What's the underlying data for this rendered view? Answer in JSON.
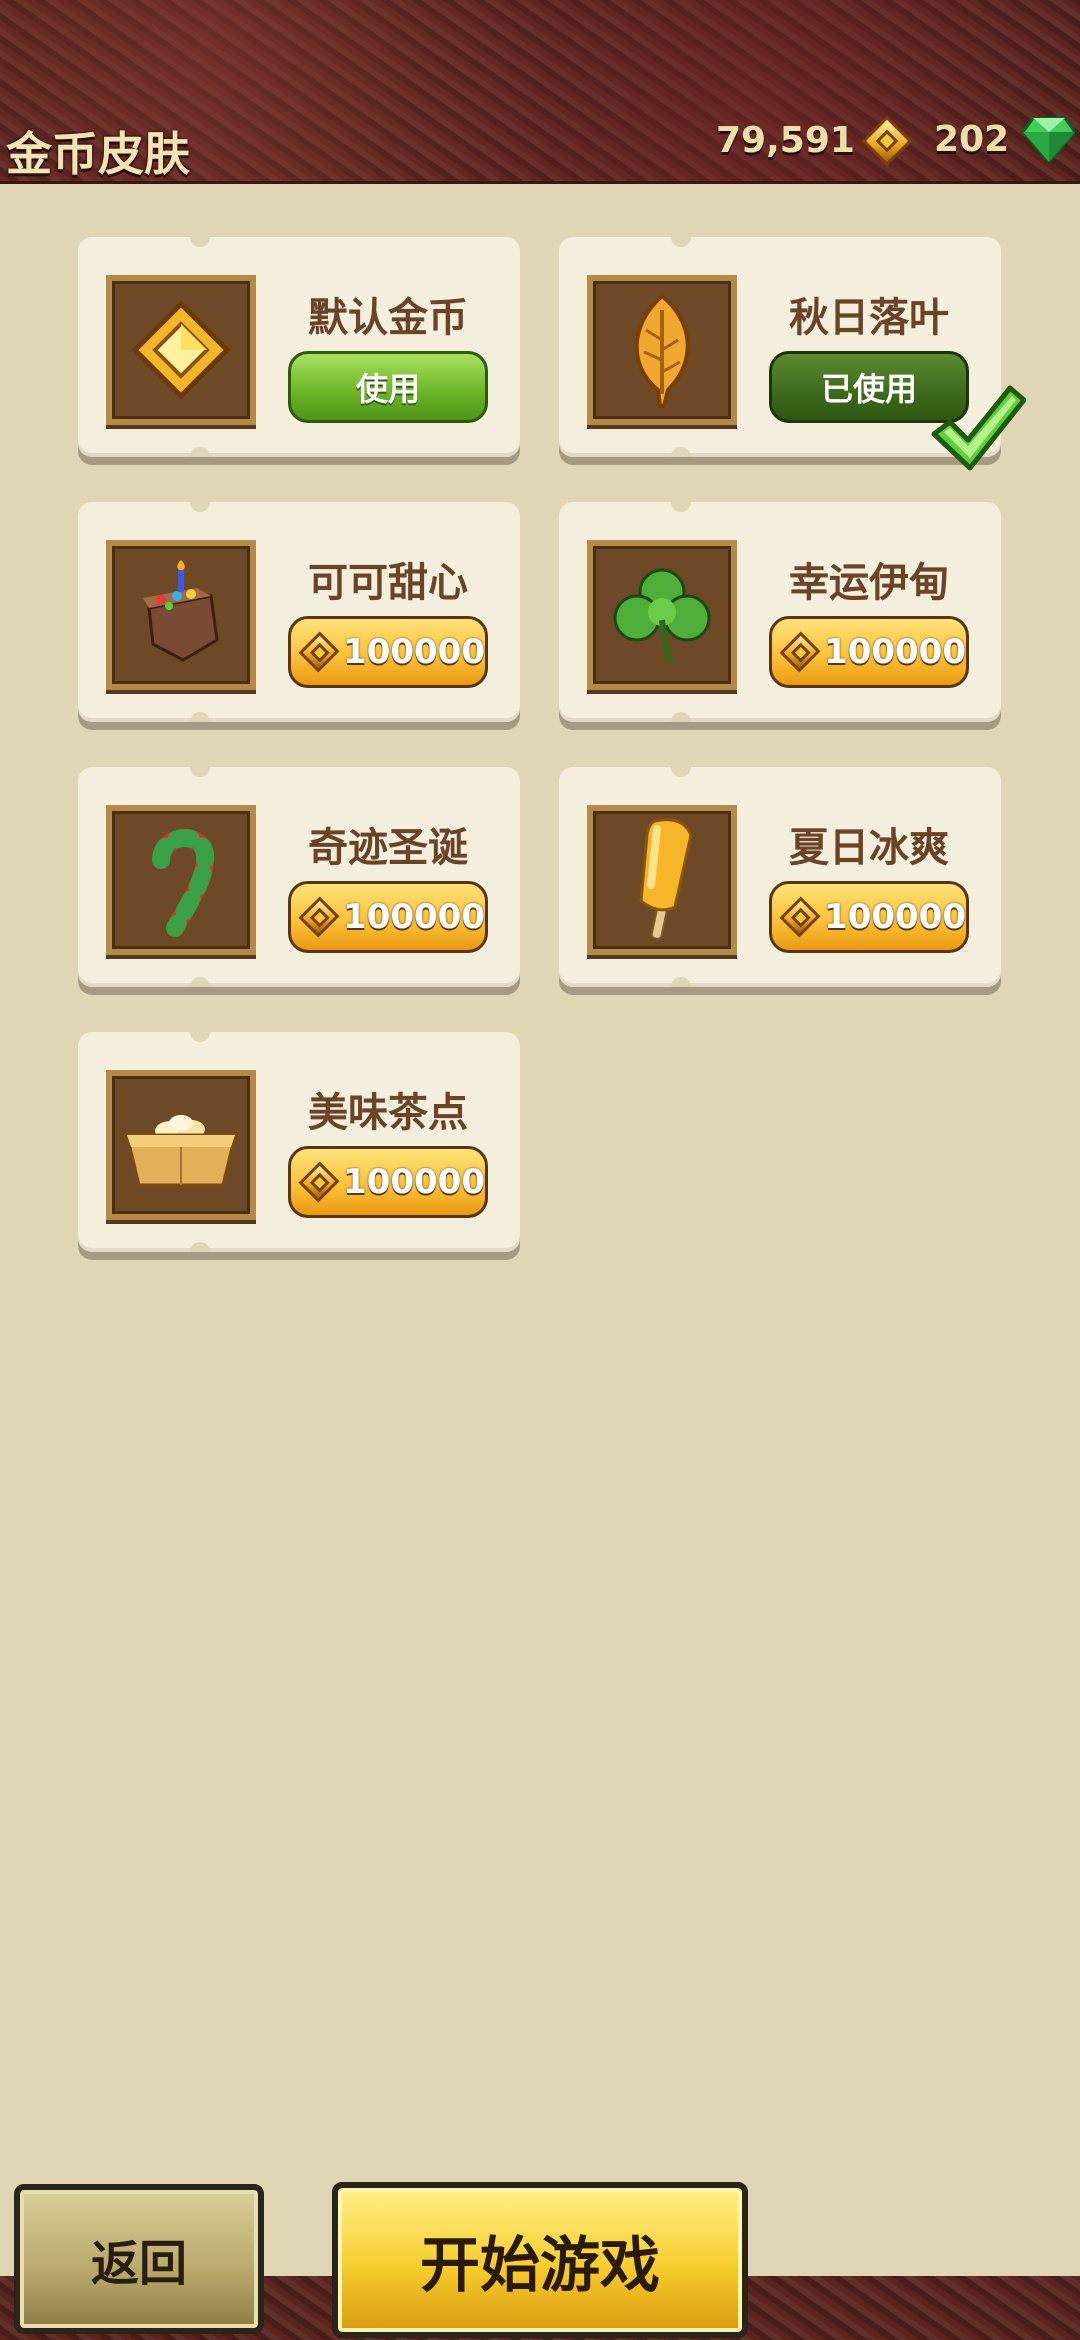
{
  "header": {
    "title": "金币皮肤",
    "coins": "79,591",
    "gems": "202"
  },
  "skins": [
    {
      "name": "默认金币",
      "button": "使用",
      "state": "use",
      "icon": "coin-diamond-icon"
    },
    {
      "name": "秋日落叶",
      "button": "已使用",
      "state": "in-use",
      "icon": "autumn-leaf-icon"
    },
    {
      "name": "可可甜心",
      "button": "100000",
      "state": "buy",
      "icon": "chocolate-cake-icon"
    },
    {
      "name": "幸运伊甸",
      "button": "100000",
      "state": "buy",
      "icon": "clover-icon"
    },
    {
      "name": "奇迹圣诞",
      "button": "100000",
      "state": "buy",
      "icon": "candy-cane-icon"
    },
    {
      "name": "夏日冰爽",
      "button": "100000",
      "state": "buy",
      "icon": "popsicle-icon"
    },
    {
      "name": "美味茶点",
      "button": "100000",
      "state": "buy",
      "icon": "pastry-box-icon"
    }
  ],
  "footer": {
    "back_label": "返回",
    "start_label": "开始游戏"
  },
  "colors": {
    "background": "#e0d6b6",
    "header": "#4a1d1a",
    "use_button": "#6fb82a",
    "used_button": "#3d6a1c",
    "price_button": "#f9c23a"
  }
}
